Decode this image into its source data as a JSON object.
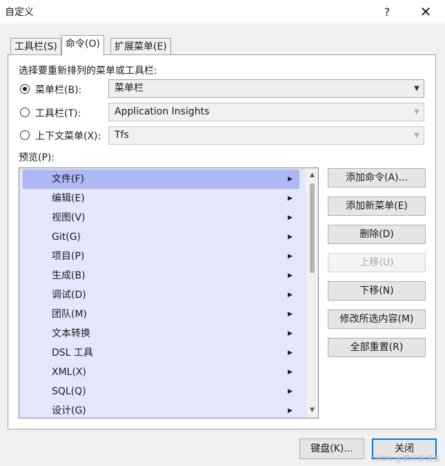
{
  "window": {
    "title": "自定义",
    "help_glyph": "?",
    "close_glyph": "✕"
  },
  "tabs": [
    {
      "label": "工具栏(S)",
      "active": false
    },
    {
      "label": "命令(O)",
      "active": true
    },
    {
      "label": "扩展菜单(E)",
      "active": false
    }
  ],
  "section_label": "选择要重新排列的菜单或工具栏:",
  "options": [
    {
      "label": "菜单栏(B):",
      "selected": true,
      "combo_value": "菜单栏",
      "combo_enabled": true
    },
    {
      "label": "工具栏(T):",
      "selected": false,
      "combo_value": "Application Insights",
      "combo_enabled": false
    },
    {
      "label": "上下文菜单(X):",
      "selected": false,
      "combo_value": "Tfs",
      "combo_enabled": false
    }
  ],
  "preview_label": "预览(P):",
  "preview_items": [
    {
      "label": "文件(F)",
      "selected": true
    },
    {
      "label": "编辑(E)",
      "selected": false
    },
    {
      "label": "视图(V)",
      "selected": false
    },
    {
      "label": "Git(G)",
      "selected": false
    },
    {
      "label": "项目(P)",
      "selected": false
    },
    {
      "label": "生成(B)",
      "selected": false
    },
    {
      "label": "调试(D)",
      "selected": false
    },
    {
      "label": "团队(M)",
      "selected": false
    },
    {
      "label": "文本转换",
      "selected": false
    },
    {
      "label": "DSL 工具",
      "selected": false
    },
    {
      "label": "XML(X)",
      "selected": false
    },
    {
      "label": "SQL(Q)",
      "selected": false
    },
    {
      "label": "设计(G)",
      "selected": false
    }
  ],
  "actions": [
    {
      "label": "添加命令(A)...",
      "enabled": true
    },
    {
      "label": "添加新菜单(E)",
      "enabled": true
    },
    {
      "label": "删除(D)",
      "enabled": true
    },
    {
      "label": "上移(U)",
      "enabled": false
    },
    {
      "label": "下移(N)",
      "enabled": true
    },
    {
      "label": "修改所选内容(M)",
      "enabled": true
    },
    {
      "label": "全部重置(R)",
      "enabled": true
    }
  ],
  "footer": {
    "keyboard_label": "键盘(K)...",
    "close_label": "关闭",
    "watermark": "CSDN @枫叶新城录"
  },
  "colors": {
    "selection": "#aeb8f5",
    "list_background": "#e4e7fb",
    "default_button_border": "#0078d7"
  }
}
